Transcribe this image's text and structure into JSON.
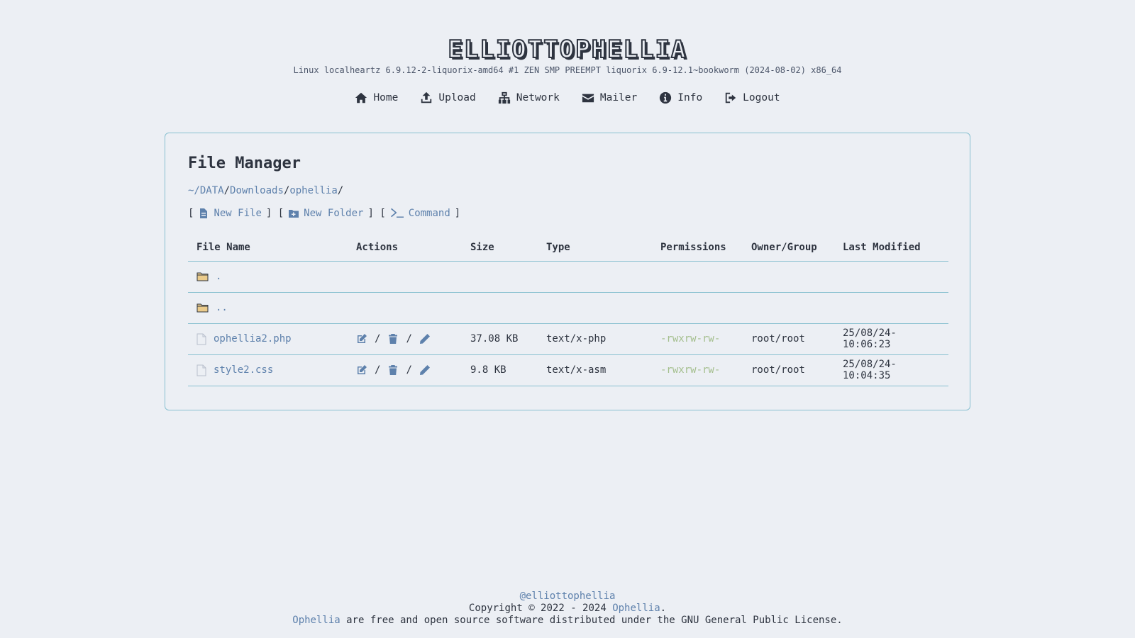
{
  "header": {
    "title": "ELLIOTTOPHELLIA",
    "uname": "Linux localheartz 6.9.12-2-liquorix-amd64 #1 ZEN SMP PREEMPT liquorix 6.9-12.1~bookworm (2024-08-02) x86_64"
  },
  "nav": [
    {
      "label": "Home",
      "icon": "home-icon"
    },
    {
      "label": "Upload",
      "icon": "upload-icon"
    },
    {
      "label": "Network",
      "icon": "network-icon"
    },
    {
      "label": "Mailer",
      "icon": "mail-icon"
    },
    {
      "label": "Info",
      "icon": "info-icon"
    },
    {
      "label": "Logout",
      "icon": "logout-icon"
    }
  ],
  "panel": {
    "title": "File Manager",
    "path": {
      "prefix": "~/",
      "parts": [
        "DATA",
        "Downloads",
        "ophellia"
      ]
    },
    "toolbar": {
      "new_file": "New File",
      "new_folder": "New Folder",
      "command": "Command"
    }
  },
  "table": {
    "columns": [
      "File Name",
      "Actions",
      "Size",
      "Type",
      "Permissions",
      "Owner/Group",
      "Last Modified"
    ],
    "rows": [
      {
        "kind": "folder",
        "name": ".",
        "size": "",
        "type": "",
        "perms": "",
        "owner": "",
        "modified": ""
      },
      {
        "kind": "folder",
        "name": "..",
        "size": "",
        "type": "",
        "perms": "",
        "owner": "",
        "modified": ""
      },
      {
        "kind": "file",
        "name": "ophellia2.php",
        "size": "37.08 KB",
        "type": "text/x-php",
        "perms": "-rwxrw-rw-",
        "owner": "root/root",
        "modified": "25/08/24-10:06:23"
      },
      {
        "kind": "file",
        "name": "style2.css",
        "size": "9.8 KB",
        "type": "text/x-asm",
        "perms": "-rwxrw-rw-",
        "owner": "root/root",
        "modified": "25/08/24-10:04:35"
      }
    ],
    "action_separator": "/"
  },
  "footer": {
    "handle": "@elliottophellia",
    "copyright_prefix": "Copyright © 2022 - 2024 ",
    "copyright_link": "Ophellia",
    "copyright_suffix": ".",
    "license_link": "Ophellia",
    "license_text": " are free and open source software distributed under the GNU General Public License."
  },
  "colors": {
    "background": "#eceff4",
    "text": "#2e3440",
    "link": "#5e81ac",
    "border": "#88c0d0",
    "permissions": "#a3be8c",
    "folder": "#ebcb8b"
  }
}
